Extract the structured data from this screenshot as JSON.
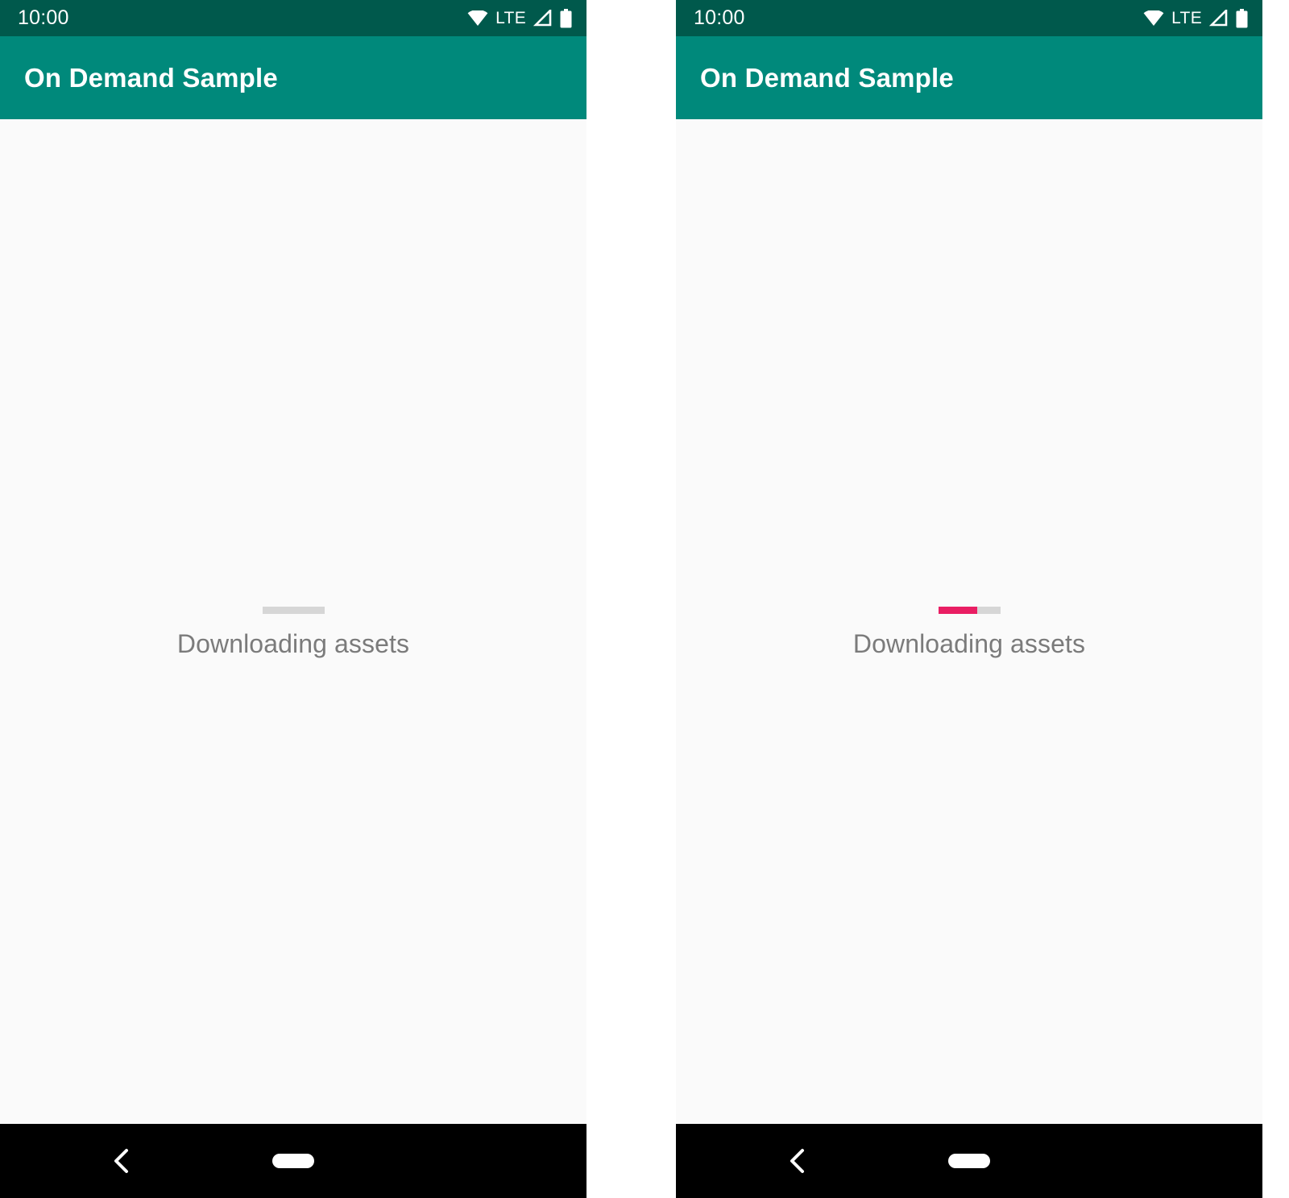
{
  "meta": {
    "platform": "android",
    "panel_count": 2,
    "description": "Two side-by-side Android phone screenshots of the On Demand Sample app showing a determinate progress bar while assets download."
  },
  "theme": {
    "status_bar_color": "#00594C",
    "app_bar_color": "#00897B",
    "app_bar_text_color": "#FFFFFF",
    "content_background": "#FAFAFA",
    "progress_track_color": "#D6D6D6",
    "progress_accent_color": "#E91E63",
    "body_text_color": "#7B7B7B",
    "nav_bar_color": "#000000"
  },
  "status_bar": {
    "clock": "10:00",
    "icons": [
      {
        "name": "wifi-icon",
        "label": "Wi-Fi"
      },
      {
        "name": "lte-label",
        "label": "LTE"
      },
      {
        "name": "cellular-signal-icon",
        "label": "Cellular signal"
      },
      {
        "name": "battery-icon",
        "label": "Battery"
      }
    ]
  },
  "nav_bar": {
    "back_label": "Back",
    "home_label": "Home",
    "back_icon": "chevron-left-icon",
    "home_icon": "home-pill-icon"
  },
  "panels": [
    {
      "id": "panel-left",
      "app_bar": {
        "title": "On Demand Sample"
      },
      "main": {
        "status_text": "Downloading assets",
        "progress": {
          "value": 0,
          "max": 100,
          "percent_label": "0%",
          "determinate": true
        }
      }
    },
    {
      "id": "panel-right",
      "app_bar": {
        "title": "On Demand Sample"
      },
      "main": {
        "status_text": "Downloading assets",
        "progress": {
          "value": 63,
          "max": 100,
          "percent_label": "63%",
          "determinate": true
        }
      }
    }
  ]
}
